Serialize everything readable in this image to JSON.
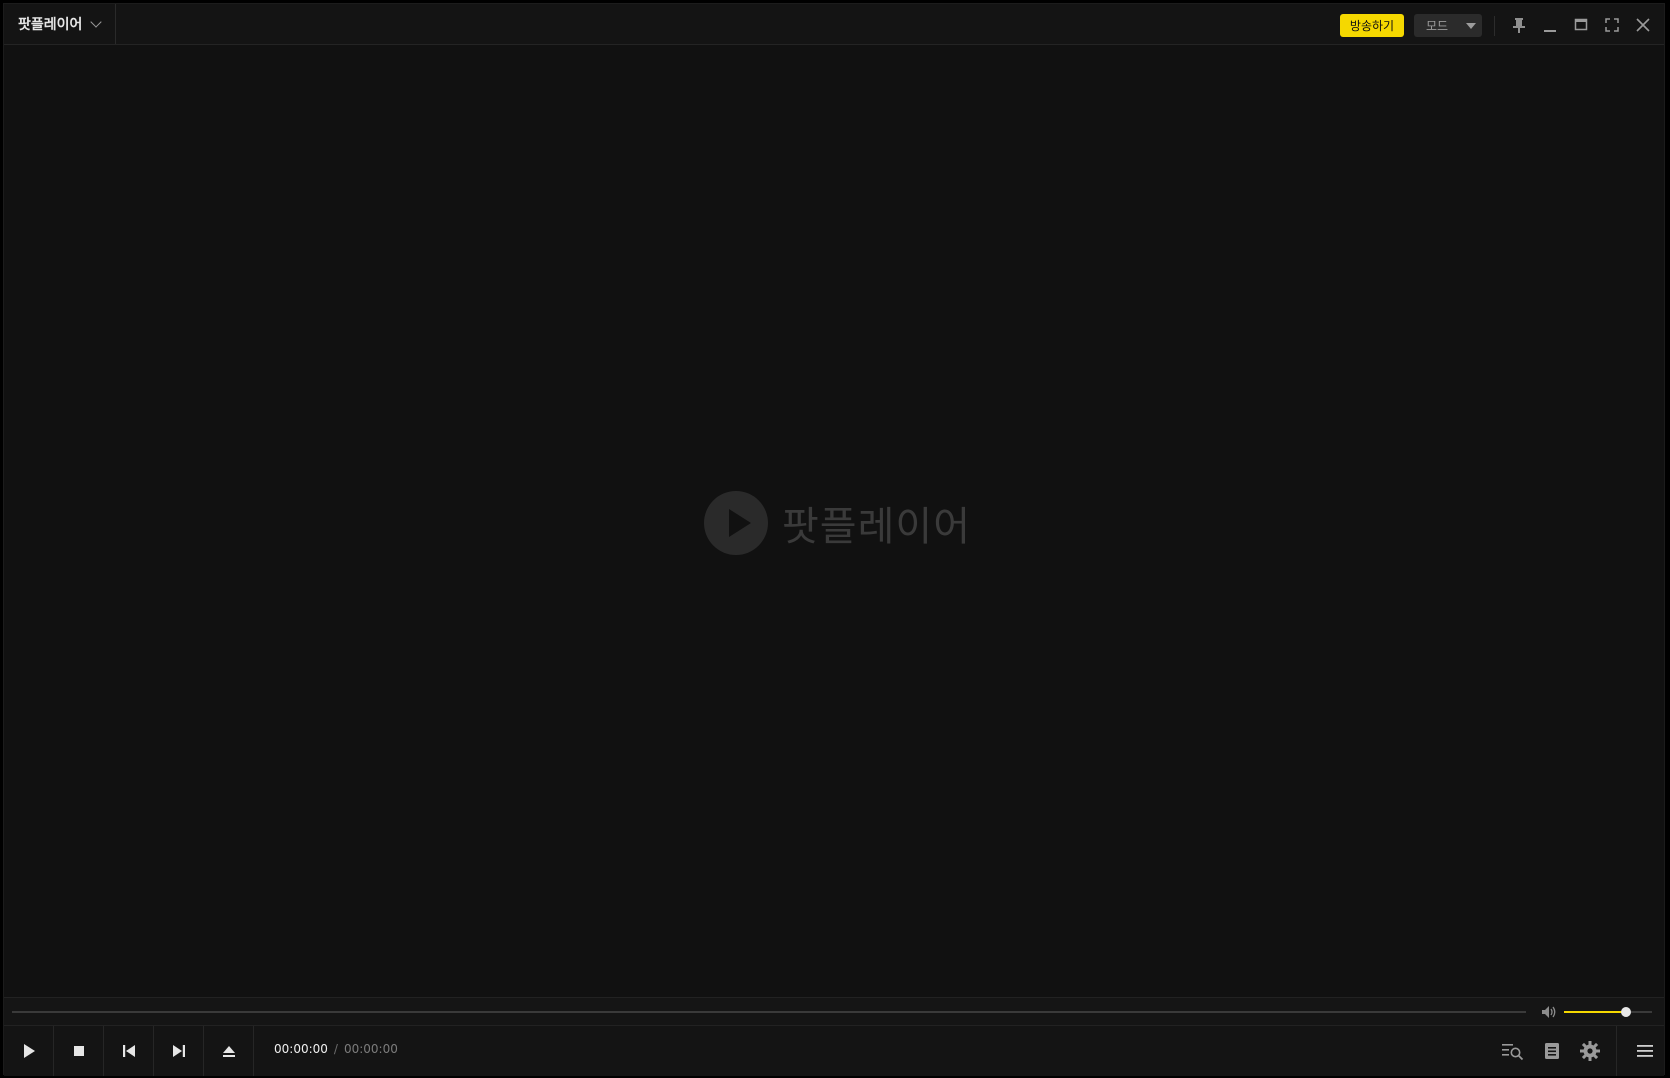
{
  "app": {
    "title": "팟플레이어",
    "logo_text": "팟플레이어"
  },
  "titlebar": {
    "broadcast_label": "방송하기",
    "mode_label": "모드",
    "icons": [
      "pin-icon",
      "minimize-icon",
      "maximize-icon",
      "fullscreen-icon",
      "close-icon"
    ]
  },
  "playback": {
    "current_time": "00:00:00",
    "separator": "/",
    "duration": "00:00:00",
    "progress": 0,
    "volume": 0.7
  },
  "controls": {
    "left": [
      "play-icon",
      "stop-icon",
      "previous-icon",
      "next-icon",
      "eject-icon"
    ],
    "right": [
      "playlist-search-icon",
      "playlist-icon",
      "settings-icon",
      "menu-icon"
    ]
  },
  "colors": {
    "accent": "#f5d800",
    "background": "#111111",
    "panel": "#141414"
  }
}
